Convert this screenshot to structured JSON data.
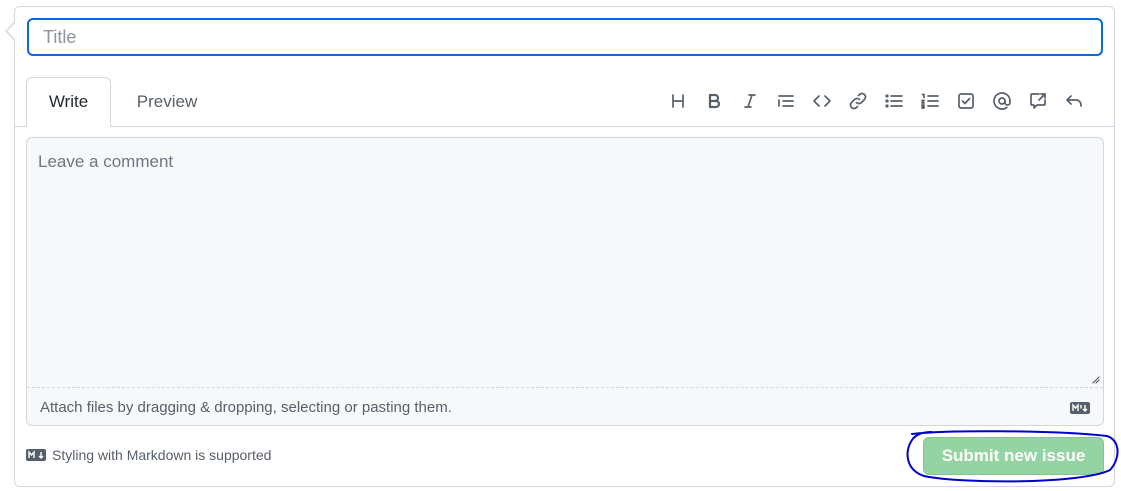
{
  "title_input": {
    "placeholder": "Title",
    "value": ""
  },
  "tabs": [
    {
      "label": "Write",
      "active": true
    },
    {
      "label": "Preview",
      "active": false
    }
  ],
  "toolbar": {
    "icons": [
      "heading-icon",
      "bold-icon",
      "italic-icon",
      "quote-icon",
      "code-icon",
      "link-icon",
      "unordered-list-icon",
      "ordered-list-icon",
      "task-list-icon",
      "mention-icon",
      "reference-icon",
      "undo-icon"
    ]
  },
  "comment": {
    "placeholder": "Leave a comment",
    "value": "",
    "attach_text": "Attach files by dragging & dropping, selecting or pasting them."
  },
  "footer": {
    "markdown_note": "Styling with Markdown is supported",
    "submit_label": "Submit new issue"
  },
  "colors": {
    "accent_blue": "#0969da",
    "submit_disabled_green": "#94d3a2",
    "annotation_ink": "#0000cc",
    "border": "#d0d7de",
    "muted_text": "#57606a"
  }
}
